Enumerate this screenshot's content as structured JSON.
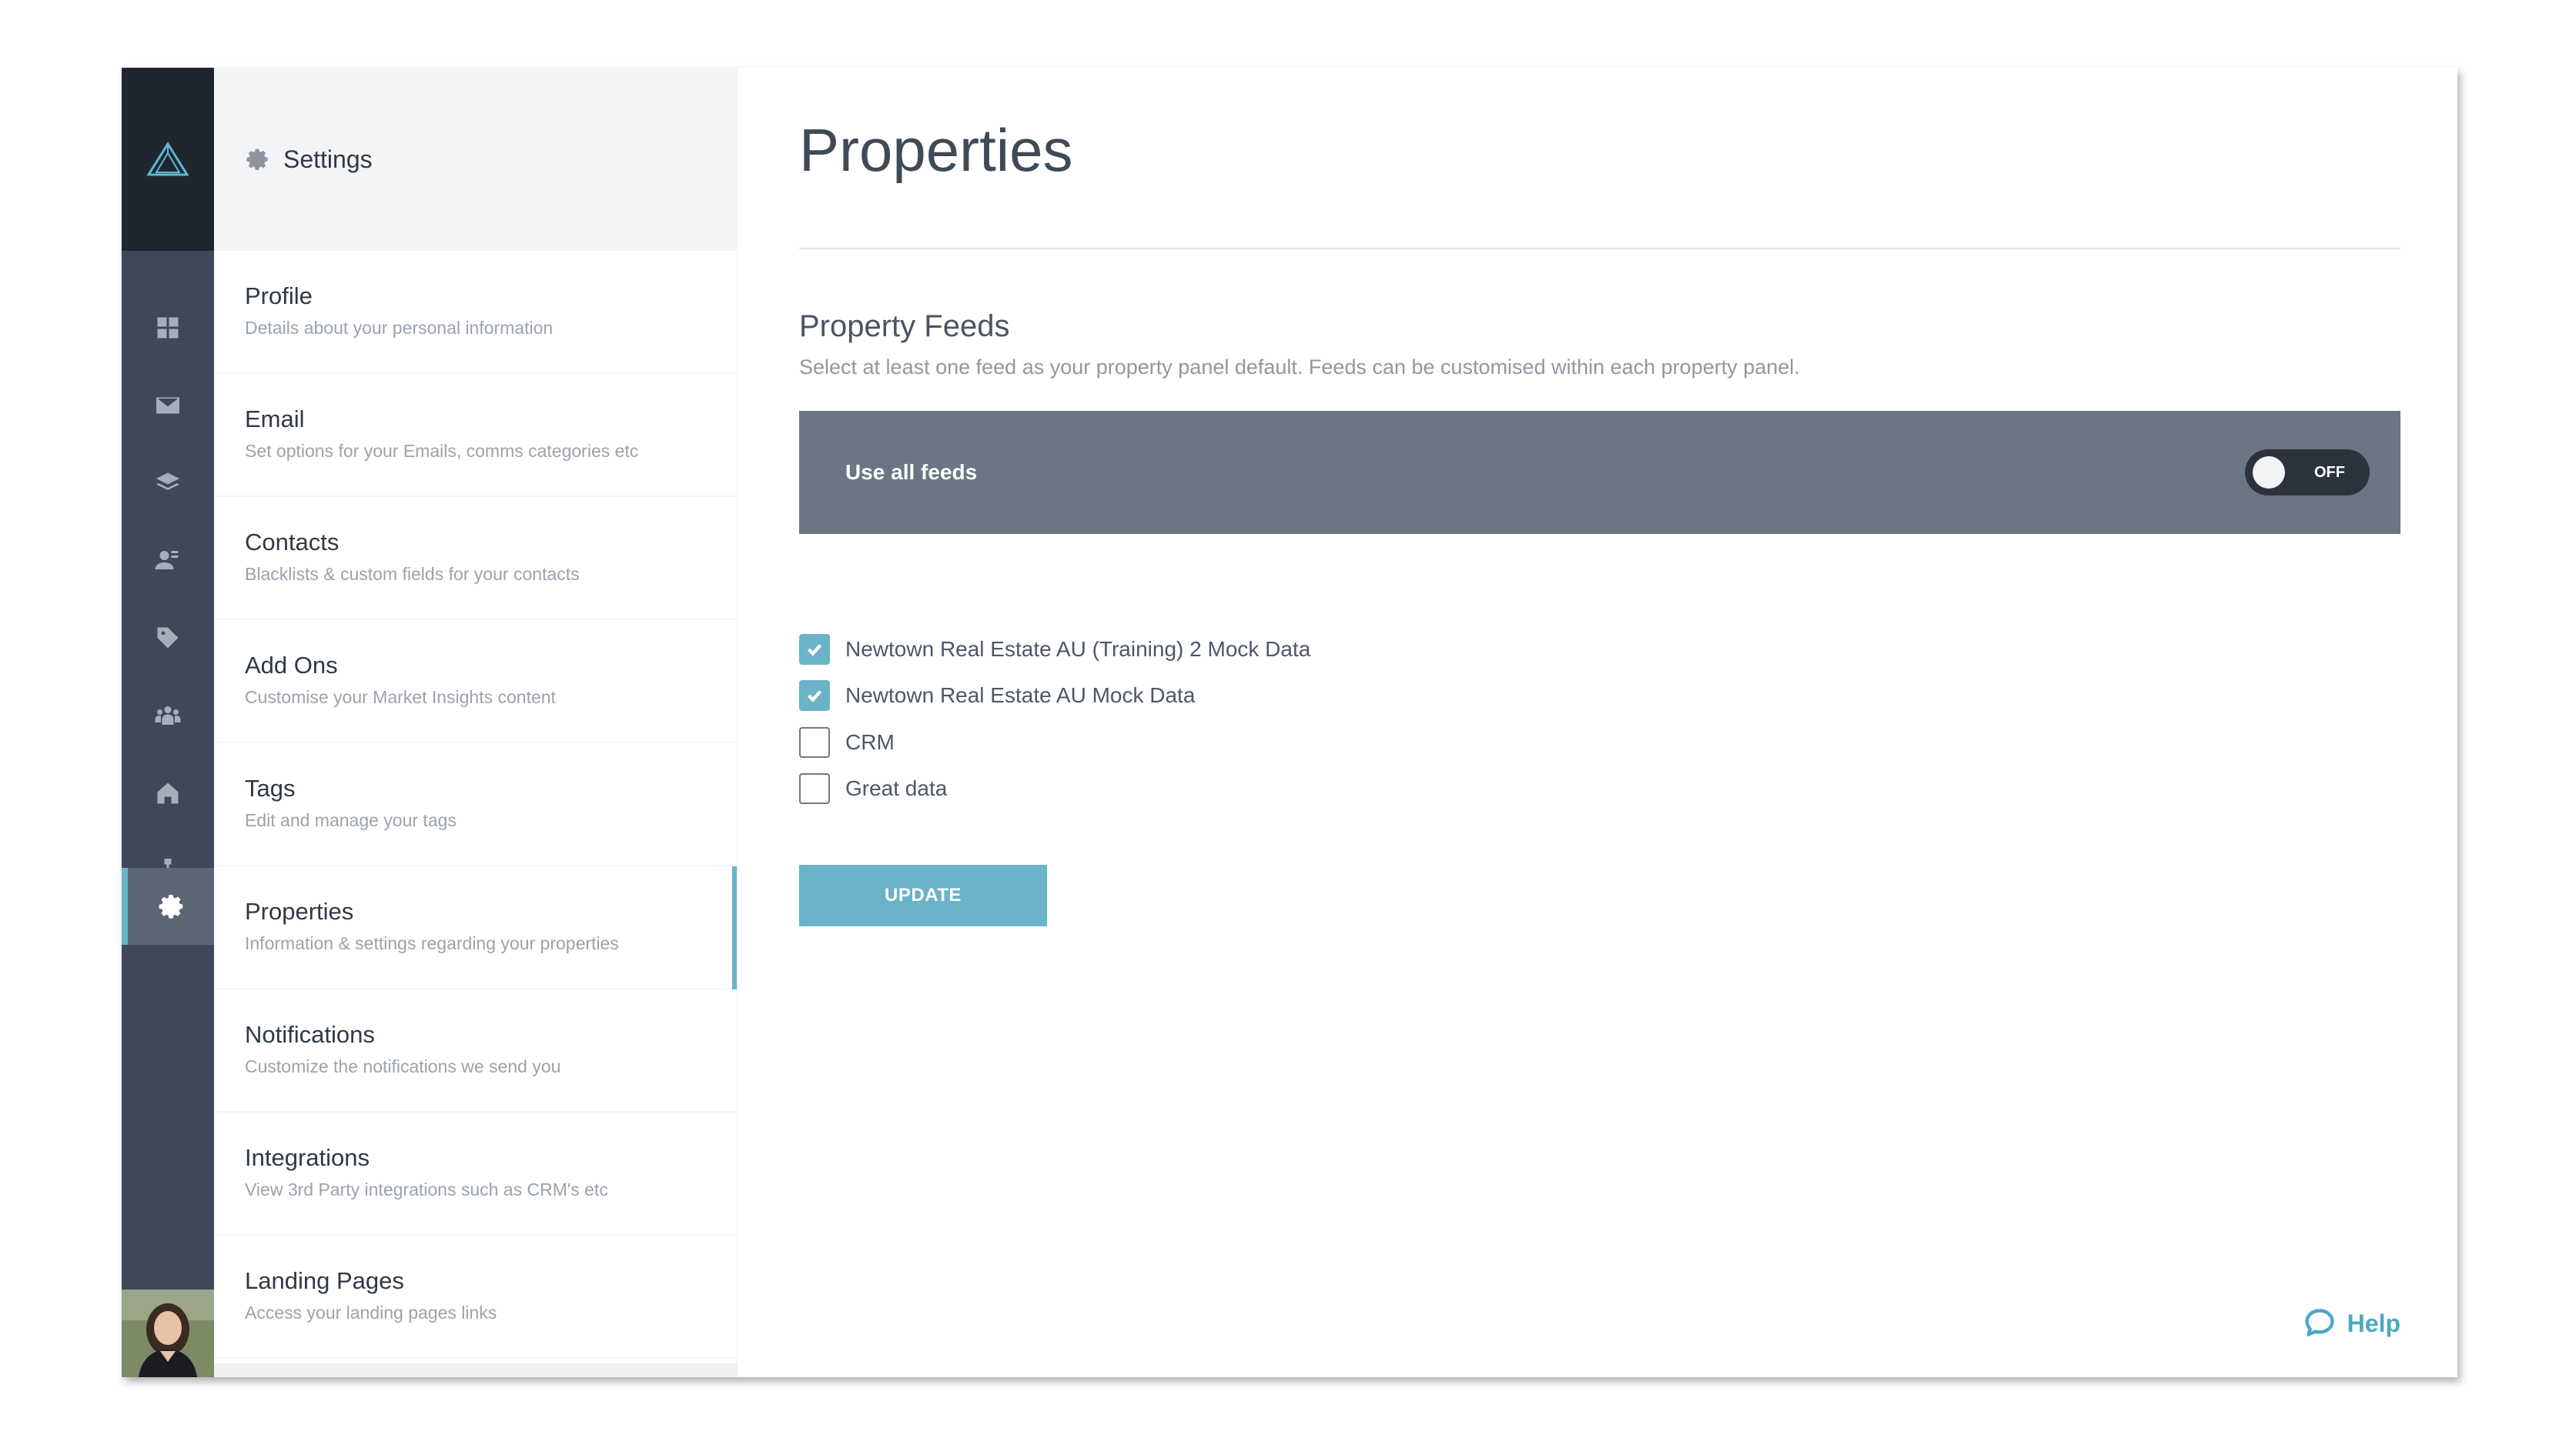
{
  "rail": {
    "icons": [
      "logo-icon",
      "dashboard-icon",
      "email-icon",
      "layers-icon",
      "contacts-icon",
      "tag-icon",
      "team-icon",
      "home-icon",
      "hierarchy-icon",
      "gear-icon"
    ],
    "active": "gear-icon"
  },
  "settings": {
    "title": "Settings",
    "items": [
      {
        "name": "Profile",
        "desc": "Details about your personal information"
      },
      {
        "name": "Email",
        "desc": "Set options for your Emails, comms categories etc"
      },
      {
        "name": "Contacts",
        "desc": "Blacklists & custom fields for your contacts"
      },
      {
        "name": "Add Ons",
        "desc": "Customise your Market Insights content"
      },
      {
        "name": "Tags",
        "desc": "Edit and manage your tags"
      },
      {
        "name": "Properties",
        "desc": "Information & settings regarding your properties"
      },
      {
        "name": "Notifications",
        "desc": "Customize the notifications we send you"
      },
      {
        "name": "Integrations",
        "desc": "View 3rd Party integrations such as CRM's etc"
      },
      {
        "name": "Landing Pages",
        "desc": "Access your landing pages links"
      }
    ],
    "active_item": "Properties"
  },
  "main": {
    "title": "Properties",
    "section_title": "Property Feeds",
    "section_desc": "Select at least one feed as your property panel default. Feeds can be customised within each property panel.",
    "use_all_feeds_label": "Use all feeds",
    "toggle_state": "OFF",
    "feeds": [
      {
        "label": "Newtown Real Estate AU (Training) 2 Mock Data",
        "checked": true
      },
      {
        "label": "Newtown Real Estate AU Mock Data",
        "checked": true
      },
      {
        "label": "CRM",
        "checked": false
      },
      {
        "label": "Great data",
        "checked": false
      }
    ],
    "update_label": "UPDATE",
    "help_label": "Help"
  },
  "colors": {
    "accent": "#6ab3c9",
    "rail_bg": "#3f4856",
    "rail_logo_bg": "#20262f",
    "feeds_bar_bg": "#6b7685"
  }
}
